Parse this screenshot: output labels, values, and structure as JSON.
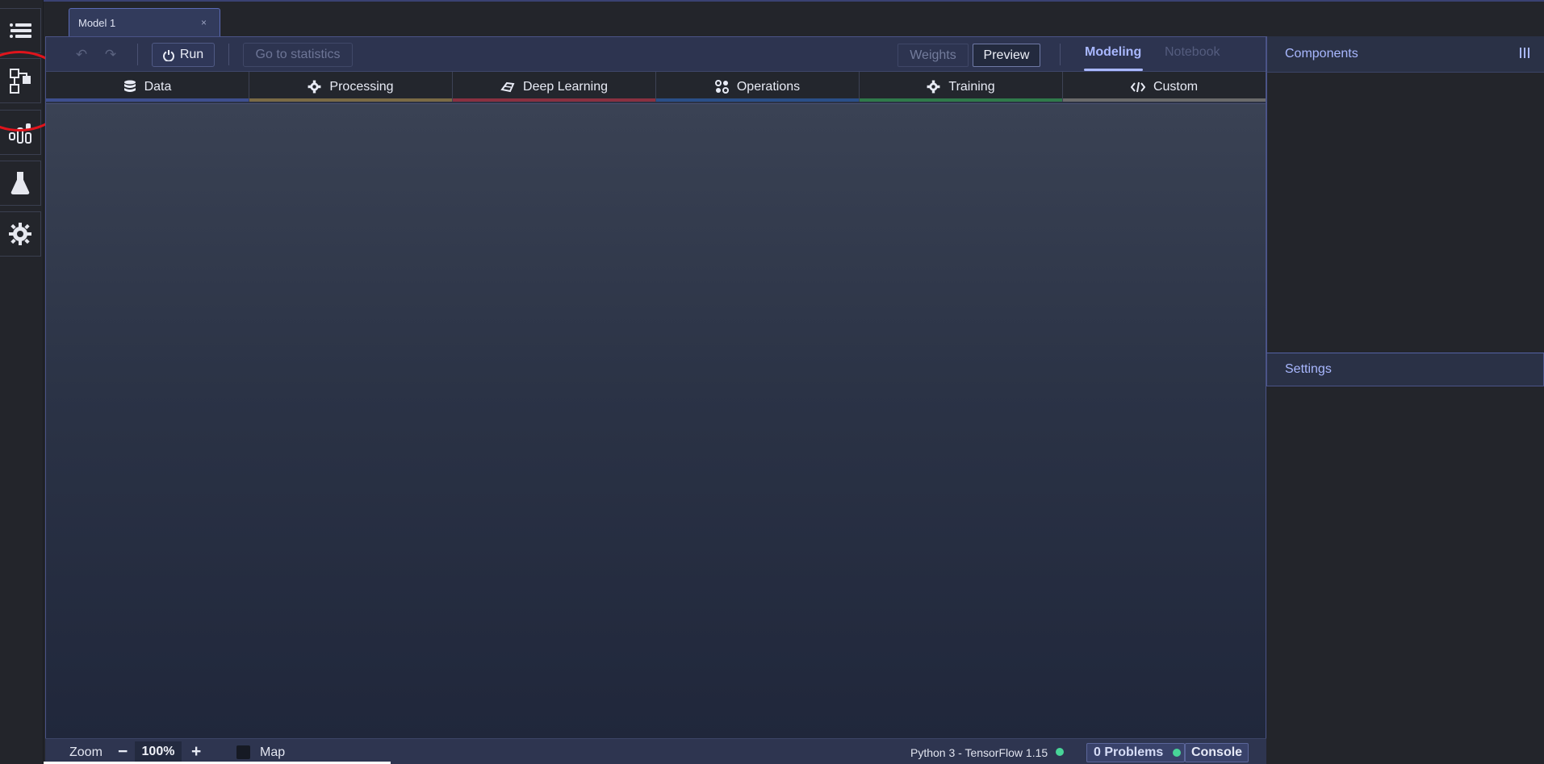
{
  "tab": {
    "title": "Model 1",
    "close": "×"
  },
  "toolbar": {
    "undo_icon": "undo-icon",
    "redo_icon": "redo-icon",
    "run_label": "Run",
    "stats_label": "Go to statistics",
    "weights_label": "Weights",
    "preview_label": "Preview",
    "modeling_label": "Modeling",
    "notebook_label": "Notebook"
  },
  "categories": [
    {
      "label": "Data",
      "icon": "database-icon",
      "color": "#3e4f8f"
    },
    {
      "label": "Processing",
      "icon": "gear-icon",
      "color": "#7a6a45"
    },
    {
      "label": "Deep Learning",
      "icon": "brain-icon",
      "color": "#8a3040"
    },
    {
      "label": "Operations",
      "icon": "grid-icon",
      "color": "#2a4f88"
    },
    {
      "label": "Training",
      "icon": "gear-icon",
      "color": "#2f7a4a"
    },
    {
      "label": "Custom",
      "icon": "code-icon",
      "color": "#6a6a6a"
    }
  ],
  "statusbar": {
    "zoom_label": "Zoom",
    "zoom_minus": "−",
    "zoom_value": "100%",
    "zoom_plus": "+",
    "map_label": "Map",
    "runtime": "Python 3 - TensorFlow 1.15",
    "problems": "0 Problems",
    "console": "Console",
    "status_color": "#48d598"
  },
  "right_panel": {
    "components_title": "Components",
    "settings_title": "Settings"
  },
  "rail": [
    "menu-icon",
    "model-graph-icon",
    "statistics-icon",
    "flask-icon",
    "settings-gear-icon"
  ]
}
